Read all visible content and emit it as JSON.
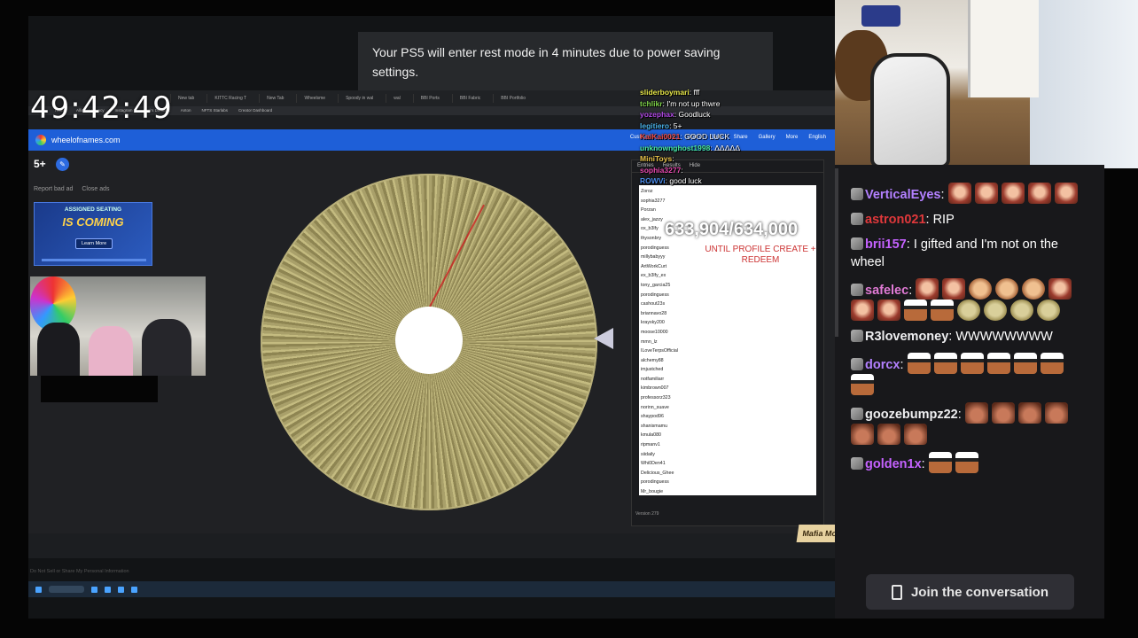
{
  "clock": "49:42:49",
  "ps5_notification": "Your PS5 will enter rest mode in 4 minutes due to power saving settings.",
  "browser": {
    "tabs": [
      "New tab",
      "KITTC Racing T",
      "New Tab",
      "Wheelsme",
      "Spoody in wal",
      "wal",
      "BBI Ports",
      "BBI Fabric",
      "BBI Portfolio"
    ],
    "bookmarks": [
      "Home",
      "Alliance Legacy",
      "Instagram",
      "Kimi's Demand",
      "Anton",
      "NFTS Starlabs",
      "Creator Dashboard"
    ]
  },
  "site": {
    "name": "wheelofnames.com",
    "menu": [
      "Customize",
      "New",
      "Open",
      "Save",
      "Share",
      "Gallery",
      "More",
      "English"
    ],
    "entry_count": "5+",
    "report_ad": "Report bad ad",
    "close_ads": "Close ads",
    "ad_title": "ASSIGNED SEATING",
    "ad_big": "IS COMING",
    "ad_button": "Learn More",
    "entries_tabs": [
      "Entries",
      "Results",
      "Hide"
    ],
    "entries": [
      "Zoroz",
      "sophia3277",
      "Porzan",
      "alex_jazzy",
      "ox_b3lfy",
      "thysonbry",
      "porodinguess",
      "millybabyyy",
      "ArtWorkCurt",
      "ex_b3lfy_ex",
      "tony_garcia25",
      "porodinguess",
      "cashout23s",
      "briannavo28",
      "krayxky200",
      "moose10000",
      "mmn_lz",
      "ILoveTerpsOfficial",
      "alchemy88",
      "imjustched",
      "notfamiliarr",
      "kimbrown007",
      "professorz323",
      "norinn_suave",
      "shaypod96",
      "shanismamu",
      "kmula080",
      "ripmanv1",
      "siidaily",
      "Whi0Den41",
      "Delicious_Ghee",
      "porodinguess",
      "Mr_bougie"
    ],
    "version": "Version 279",
    "footer": "Do Not Sell or Share My Personal Information"
  },
  "stream_overlay": {
    "chat": [
      {
        "user": "sliderboymari",
        "text": "fff",
        "color": "#e8e84a"
      },
      {
        "user": "tchlikr",
        "text": "I'm not up thwre",
        "color": "#7fd34a"
      },
      {
        "user": "yozephax",
        "text": "Goodluck",
        "color": "#b34ae8"
      },
      {
        "user": "legitiero",
        "text": "5+",
        "color": "#4ab3e8"
      },
      {
        "user": "KaiKai0021",
        "text": "GOOD LUCK",
        "color": "#e84a4a"
      },
      {
        "user": "unknownghost1998",
        "text": "ᐃᐃᐃᐃᐃ",
        "color": "#4ae8a1"
      },
      {
        "user": "MiniToys",
        "text": "",
        "color": "#e8c24a"
      },
      {
        "user": "sophia3277",
        "text": "",
        "color": "#e84ab0"
      },
      {
        "user": "ROWVi",
        "text": "good luck",
        "color": "#4a8ae8"
      }
    ],
    "goal": "633,904/634,000",
    "goal_sub": "UNTIL PROFILE CREATE + REDEEM",
    "watermark": "Mafia Mode"
  },
  "chat": {
    "messages": [
      {
        "user": "VerticalEyes",
        "color": "#b380ff",
        "text": "",
        "emotes": [
          "e-a",
          "e-a",
          "e-a",
          "e-a",
          "e-a"
        ]
      },
      {
        "user": "astron021",
        "color": "#e0383b",
        "text": "RIP",
        "emotes": []
      },
      {
        "user": "brii157",
        "color": "#c562ff",
        "text": "I gifted and I'm not on the wheel",
        "emotes": []
      },
      {
        "user": "safelec",
        "color": "#e07ad5",
        "text": "",
        "emotes": [
          "e-a",
          "e-a",
          "e-c",
          "e-c",
          "e-c",
          "e-a",
          "e-a",
          "e-a",
          "e-b",
          "e-b",
          "e-d",
          "e-d",
          "e-d",
          "e-d"
        ]
      },
      {
        "user": "R3lovemoney",
        "color": "#efeff1",
        "text": "WWWWWWWW",
        "emotes": []
      },
      {
        "user": "dorcx",
        "color": "#b380ff",
        "text": "",
        "emotes": [
          "e-b",
          "e-b",
          "e-b",
          "e-b",
          "e-b",
          "e-b",
          "e-b"
        ]
      },
      {
        "user": "goozebumpz22",
        "color": "#efeff1",
        "text": "",
        "emotes": [
          "e-e",
          "e-e",
          "e-e",
          "e-e",
          "e-e",
          "e-e",
          "e-e"
        ]
      },
      {
        "user": "golden1x",
        "color": "#c562ff",
        "text": "",
        "emotes": [
          "e-b",
          "e-b"
        ]
      }
    ],
    "join_button": "Join the conversation"
  }
}
